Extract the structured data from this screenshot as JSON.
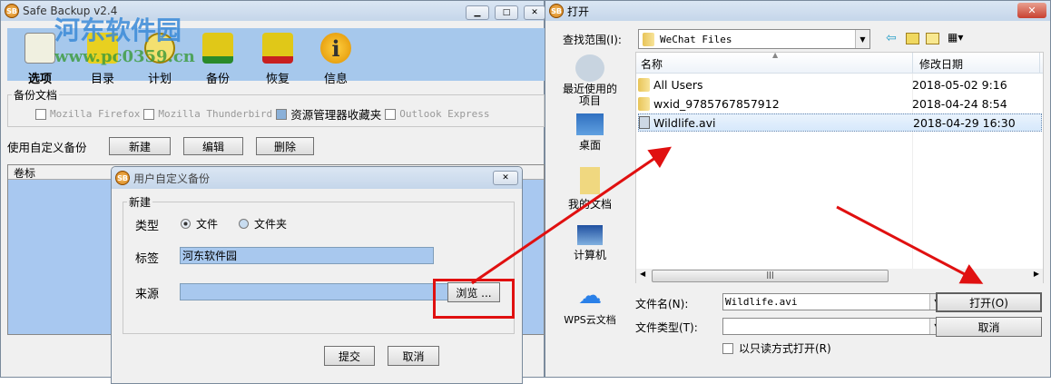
{
  "main_window": {
    "title": "Safe Backup v2.4",
    "toolbar": [
      {
        "label": "选项"
      },
      {
        "label": "目录"
      },
      {
        "label": "计划"
      },
      {
        "label": "备份"
      },
      {
        "label": "恢复"
      },
      {
        "label": "信息"
      }
    ],
    "group_label": "备份文档",
    "checkboxes": [
      {
        "label": "Mozilla Firefox"
      },
      {
        "label": "Mozilla Thunderbird"
      },
      {
        "label": "资源管理器收藏夹"
      },
      {
        "label": "Outlook Express"
      }
    ],
    "custom_label": "使用自定义备份",
    "new_btn": "新建",
    "edit_btn": "编辑",
    "delete_btn": "删除",
    "list_header": "卷标"
  },
  "watermark": {
    "logo_text": "河东软件园",
    "url": "www.pc0359.cn"
  },
  "custom_dialog": {
    "title": "用户自定义备份",
    "group_label": "新建",
    "type_label": "类型",
    "radio_file": "文件",
    "radio_folder": "文件夹",
    "tag_label": "标签",
    "tag_value": "河东软件园",
    "source_label": "来源",
    "source_value": "",
    "browse_btn": "浏览 ...",
    "submit_btn": "提交",
    "cancel_btn": "取消"
  },
  "open_dialog": {
    "title": "打开",
    "look_in_label": "查找范围(I):",
    "look_in_value": "WeChat Files",
    "places": [
      {
        "label": "最近使用的项目"
      },
      {
        "label": "桌面"
      },
      {
        "label": "我的文档"
      },
      {
        "label": "计算机"
      },
      {
        "label": "WPS云文档"
      }
    ],
    "columns": [
      "名称",
      "修改日期"
    ],
    "files": [
      {
        "name": "All Users",
        "date": "2018-05-02 9:16",
        "type": "folder"
      },
      {
        "name": "wxid_9785767857912",
        "date": "2018-04-24 8:54",
        "type": "folder"
      },
      {
        "name": "Wildlife.avi",
        "date": "2018-04-29 16:30",
        "type": "video",
        "selected": true
      }
    ],
    "filename_label": "文件名(N):",
    "filename_value": "Wildlife.avi",
    "filetype_label": "文件类型(T):",
    "filetype_value": "",
    "readonly_label": "以只读方式打开(R)",
    "open_btn": "打开(O)",
    "cancel_btn": "取消"
  },
  "colors": {
    "toolbar_blue": "#a6c8ec",
    "arrow_red": "#e01010"
  }
}
